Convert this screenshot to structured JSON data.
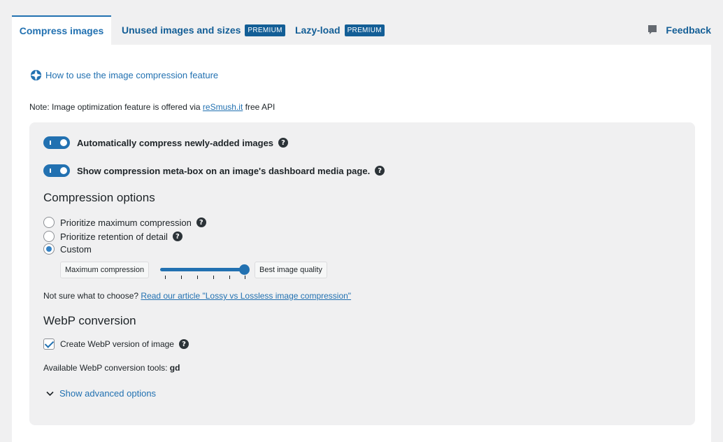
{
  "tabs": [
    {
      "label": "Compress images"
    },
    {
      "label": "Unused images and sizes",
      "badge": "PREMIUM"
    },
    {
      "label": "Lazy-load",
      "badge": "PREMIUM"
    }
  ],
  "feedback": {
    "label": "Feedback",
    "icon": "speech-bubble-icon"
  },
  "howto": {
    "label": "How to use the image compression feature",
    "icon": "lifebuoy-icon"
  },
  "note": {
    "prefix": "Note: Image optimization feature is offered via ",
    "link": "reSmush.it",
    "suffix": " free API"
  },
  "toggles": [
    {
      "label": "Automatically compress newly-added images",
      "on": true
    },
    {
      "label": "Show compression meta-box on an image's dashboard media page.",
      "on": true
    }
  ],
  "help_glyph": "?",
  "compression": {
    "heading": "Compression options",
    "options": [
      {
        "label": "Prioritize maximum compression",
        "checked": false
      },
      {
        "label": "Prioritize retention of detail",
        "checked": false
      },
      {
        "label": "Custom",
        "checked": true
      }
    ],
    "slider": {
      "min_label": "Maximum compression",
      "max_label": "Best image quality",
      "value_fraction": 1.0
    }
  },
  "choose": {
    "prefix": "Not sure what to choose? ",
    "link": "Read our article \"Lossy vs Lossless image compression\""
  },
  "webp": {
    "heading": "WebP conversion",
    "checkbox_label": "Create WebP version of image",
    "checked": true,
    "tools_prefix": "Available WebP conversion tools: ",
    "tools_value": "gd"
  },
  "advanced": {
    "label": "Show advanced options"
  },
  "colors": {
    "accent": "#2271b1",
    "link": "#135e96",
    "background": "#f0f0f1"
  }
}
